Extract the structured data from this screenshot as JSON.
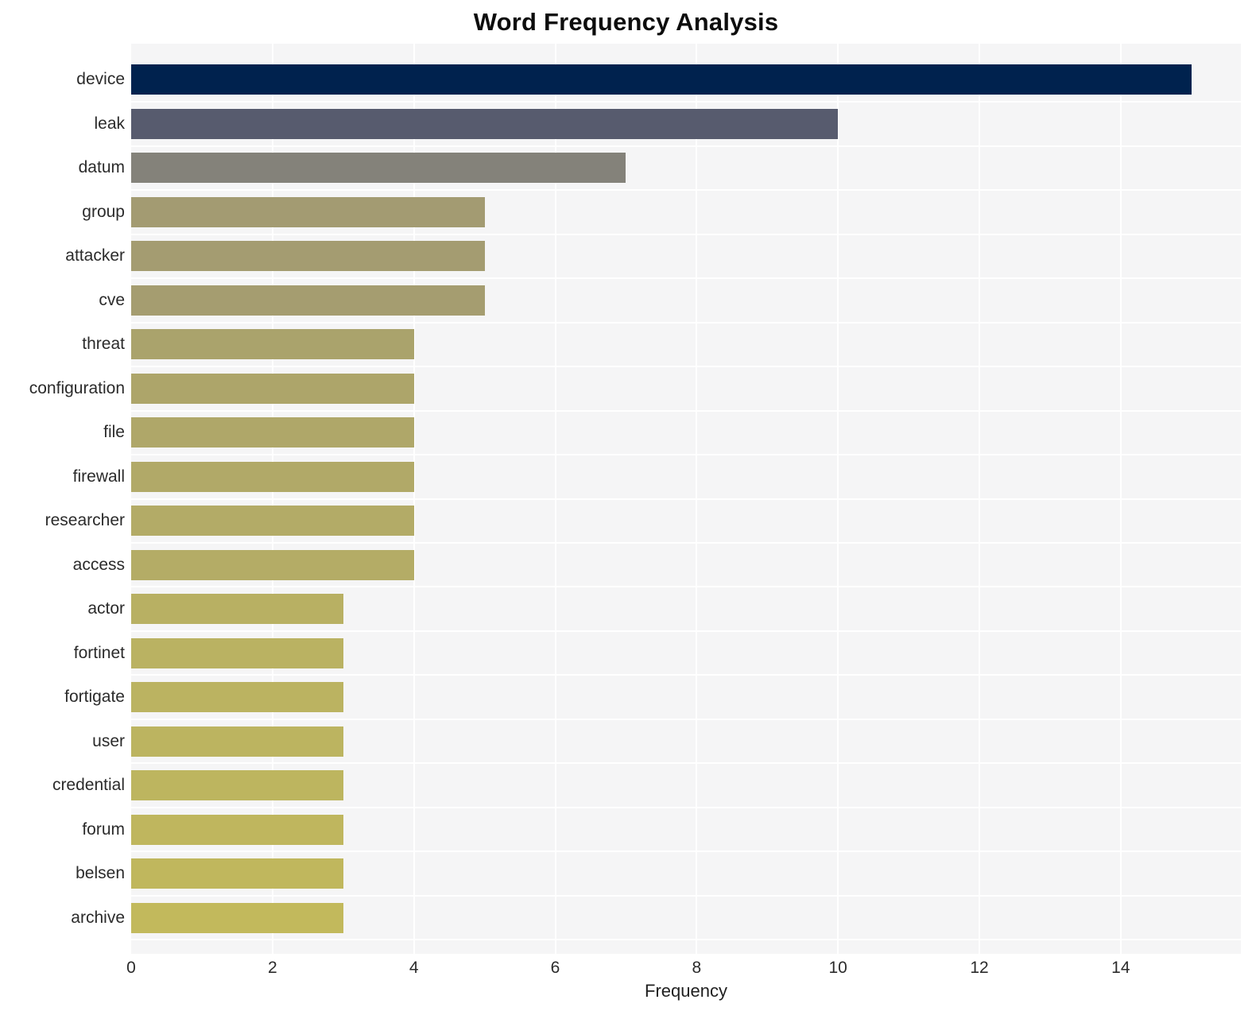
{
  "chart_data": {
    "type": "bar",
    "orientation": "horizontal",
    "title": "Word Frequency Analysis",
    "xlabel": "Frequency",
    "ylabel": "",
    "categories": [
      "device",
      "leak",
      "datum",
      "group",
      "attacker",
      "cve",
      "threat",
      "configuration",
      "file",
      "firewall",
      "researcher",
      "access",
      "actor",
      "fortinet",
      "fortigate",
      "user",
      "credential",
      "forum",
      "belsen",
      "archive"
    ],
    "values": [
      15,
      10,
      7,
      5,
      5,
      5,
      4,
      4,
      4,
      4,
      4,
      4,
      3,
      3,
      3,
      3,
      3,
      3,
      3,
      3
    ],
    "xticks": [
      0,
      2,
      4,
      6,
      8,
      10,
      12,
      14
    ],
    "xtick_labels": [
      "0",
      "2",
      "4",
      "6",
      "8",
      "10",
      "12",
      "14"
    ],
    "xlim": [
      0,
      15.7
    ],
    "grid": true,
    "legend": "none",
    "bar_colors": [
      "#00224e",
      "#575b6e",
      "#84827a",
      "#a39b72",
      "#a49c71",
      "#a59d70",
      "#aaa36c",
      "#ada56a",
      "#afa769",
      "#b1a968",
      "#b3ab67",
      "#b4ac66",
      "#b8b063",
      "#bab262",
      "#bbb361",
      "#bcb460",
      "#bdb55f",
      "#bfb65e",
      "#c0b75d",
      "#c2b95c"
    ],
    "plot_background": "#f5f5f6",
    "grid_color": "#ffffff",
    "figure_background": "#ffffff",
    "text_color": "#2b2b2b"
  }
}
